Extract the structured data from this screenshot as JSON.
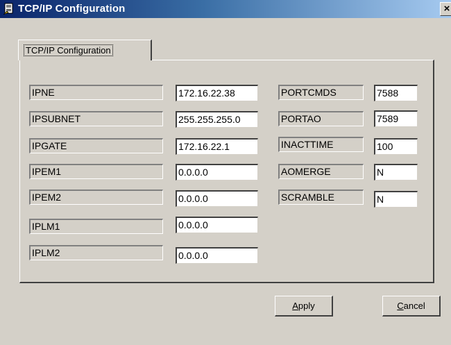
{
  "window": {
    "title": "TCP/IP Configuration",
    "close_glyph": "×"
  },
  "tab": {
    "label": "TCP/IP Configuration"
  },
  "left_fields": [
    {
      "label": "IPNE",
      "value": "172.16.22.38"
    },
    {
      "label": "IPSUBNET",
      "value": "255.255.255.0"
    },
    {
      "label": "IPGATE",
      "value": "172.16.22.1"
    },
    {
      "label": "IPEM1",
      "value": "0.0.0.0"
    },
    {
      "label": "IPEM2",
      "value": "0.0.0.0"
    },
    {
      "label": "IPLM1",
      "value": "0.0.0.0"
    },
    {
      "label": "IPLM2",
      "value": "0.0.0.0"
    }
  ],
  "right_fields": [
    {
      "label": "PORTCMDS",
      "value": "7588"
    },
    {
      "label": "PORTAO",
      "value": "7589"
    },
    {
      "label": "INACTTIME",
      "value": "100"
    },
    {
      "label": "AOMERGE",
      "value": "N"
    },
    {
      "label": "SCRAMBLE",
      "value": "N"
    }
  ],
  "buttons": {
    "apply_first": "A",
    "apply_rest": "pply",
    "cancel_first": "C",
    "cancel_rest": "ancel"
  }
}
